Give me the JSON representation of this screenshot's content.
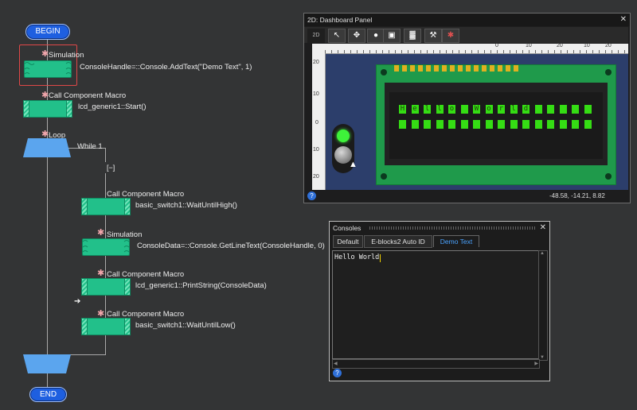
{
  "flowchart": {
    "begin_label": "BEGIN",
    "end_label": "END",
    "loop_label": "Loop",
    "loop_condition": "While 1",
    "collapse_label": "[−]",
    "icons": {
      "star": "star-icon",
      "arrow": "execution-arrow-icon"
    },
    "blocks": [
      {
        "title": "Simulation",
        "code": "ConsoleHandle=::Console.AddText(\"Demo Text\", 1)"
      },
      {
        "title": "Call Component Macro",
        "code": "lcd_generic1::Start()"
      },
      {
        "title": "Call Component Macro",
        "code": "basic_switch1::WaitUntilHigh()"
      },
      {
        "title": "Simulation",
        "code": "ConsoleData=::Console.GetLineText(ConsoleHandle, 0)"
      },
      {
        "title": "Call Component Macro",
        "code": "lcd_generic1::PrintString(ConsoleData)"
      },
      {
        "title": "Call Component Macro",
        "code": "basic_switch1::WaitUntilLow()"
      }
    ]
  },
  "dashboard": {
    "title": "2D: Dashboard Panel",
    "close_label": "✕",
    "toolbar": [
      {
        "icon": "2d-view-icon",
        "label": "2D"
      },
      {
        "icon": "pointer-icon",
        "label": "↖"
      },
      {
        "icon": "move-icon",
        "label": "✥"
      },
      {
        "icon": "sphere-icon",
        "label": "●"
      },
      {
        "icon": "image-icon",
        "label": "▣"
      },
      {
        "icon": "stand-icon",
        "label": "▓"
      },
      {
        "icon": "wrench-icon",
        "label": "⚒"
      },
      {
        "icon": "color-icon",
        "label": "✱"
      }
    ],
    "ruler_top": [
      "0",
      "10",
      "20",
      "10",
      "20",
      "30"
    ],
    "ruler_left": [
      "20",
      "10",
      "0",
      "10",
      "20"
    ],
    "lcd_text": "Hello World",
    "coordinates": "-48.58, -14.21, 8.82",
    "help_label": "?"
  },
  "consoles": {
    "title": "Consoles",
    "close_label": "✕",
    "tabs": [
      "Default",
      "E-blocks2 Auto ID",
      "Demo Text"
    ],
    "active_tab": "Demo Text",
    "content": "Hello World",
    "help_label": "?"
  },
  "colors": {
    "terminal": "#1e5fe0",
    "macro": "#22c08a",
    "loop": "#5ba5ee",
    "lcd_on": "#35dd14",
    "panel_bg": "#2c3e6b"
  }
}
